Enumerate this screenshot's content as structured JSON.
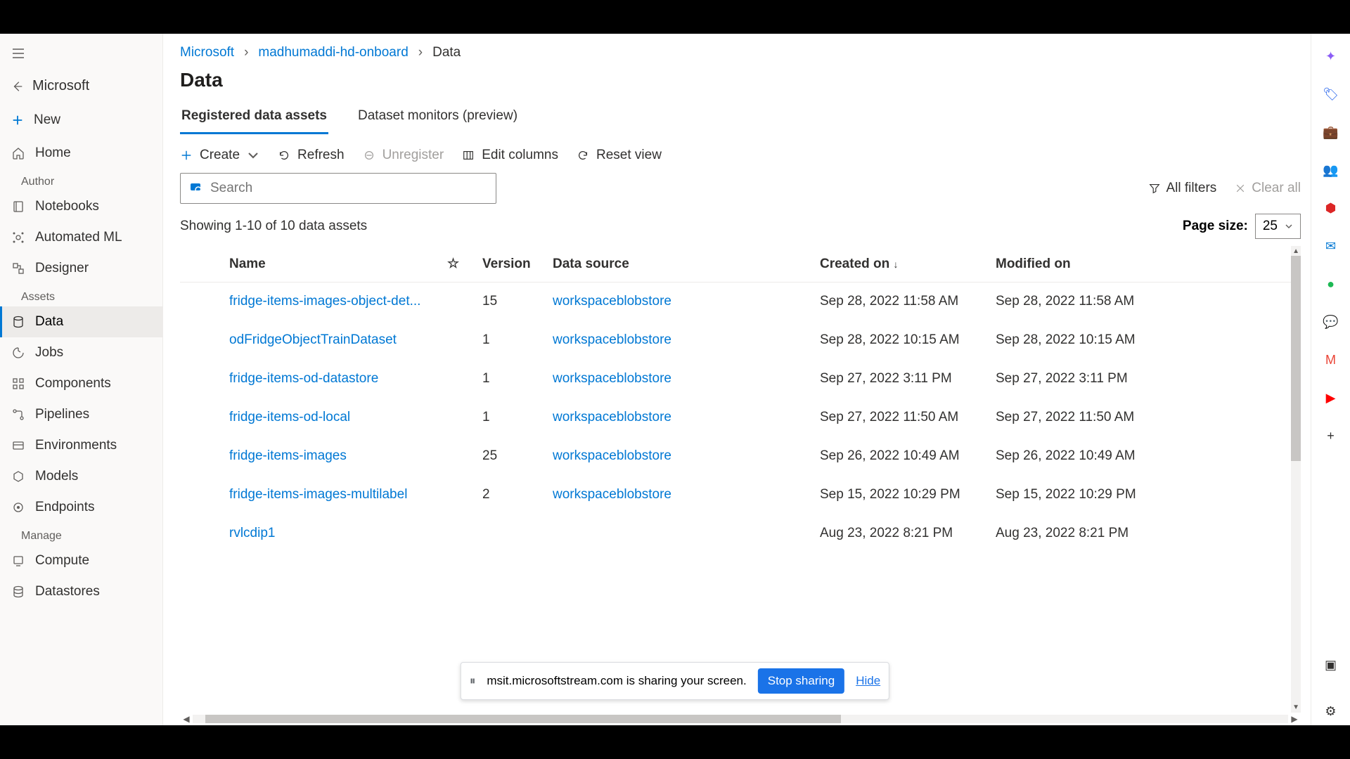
{
  "back_label": "Microsoft",
  "sidebar": {
    "new_label": "New",
    "home_label": "Home",
    "section_author": "Author",
    "notebooks": "Notebooks",
    "automl": "Automated ML",
    "designer": "Designer",
    "section_assets": "Assets",
    "data": "Data",
    "jobs": "Jobs",
    "components": "Components",
    "pipelines": "Pipelines",
    "environments": "Environments",
    "models": "Models",
    "endpoints": "Endpoints",
    "section_manage": "Manage",
    "compute": "Compute",
    "datastores": "Datastores"
  },
  "breadcrumb": {
    "root": "Microsoft",
    "workspace": "madhumaddi-hd-onboard",
    "current": "Data"
  },
  "page_title": "Data",
  "tabs": {
    "registered": "Registered data assets",
    "monitors": "Dataset monitors (preview)"
  },
  "toolbar": {
    "create": "Create",
    "refresh": "Refresh",
    "unregister": "Unregister",
    "edit_columns": "Edit columns",
    "reset_view": "Reset view"
  },
  "search_placeholder": "Search",
  "filters": {
    "all": "All filters",
    "clear": "Clear all"
  },
  "count_text": "Showing 1-10 of 10 data assets",
  "page_size_label": "Page size:",
  "page_size_value": "25",
  "columns": {
    "name": "Name",
    "version": "Version",
    "data_source": "Data source",
    "created_on": "Created on",
    "modified_on": "Modified on"
  },
  "rows": [
    {
      "name": "fridge-items-images-object-det...",
      "version": "15",
      "source": "workspaceblobstore",
      "created": "Sep 28, 2022 11:58 AM",
      "modified": "Sep 28, 2022 11:58 AM"
    },
    {
      "name": "odFridgeObjectTrainDataset",
      "version": "1",
      "source": "workspaceblobstore",
      "created": "Sep 28, 2022 10:15 AM",
      "modified": "Sep 28, 2022 10:15 AM"
    },
    {
      "name": "fridge-items-od-datastore",
      "version": "1",
      "source": "workspaceblobstore",
      "created": "Sep 27, 2022 3:11 PM",
      "modified": "Sep 27, 2022 3:11 PM"
    },
    {
      "name": "fridge-items-od-local",
      "version": "1",
      "source": "workspaceblobstore",
      "created": "Sep 27, 2022 11:50 AM",
      "modified": "Sep 27, 2022 11:50 AM"
    },
    {
      "name": "fridge-items-images",
      "version": "25",
      "source": "workspaceblobstore",
      "created": "Sep 26, 2022 10:49 AM",
      "modified": "Sep 26, 2022 10:49 AM"
    },
    {
      "name": "fridge-items-images-multilabel",
      "version": "2",
      "source": "workspaceblobstore",
      "created": "Sep 15, 2022 10:29 PM",
      "modified": "Sep 15, 2022 10:29 PM"
    },
    {
      "name": "rvlcdip1",
      "version": "",
      "source": "",
      "created": "Aug 23, 2022 8:21 PM",
      "modified": "Aug 23, 2022 8:21 PM"
    }
  ],
  "share_bar": {
    "text": "msit.microsoftstream.com is sharing your screen.",
    "stop": "Stop sharing",
    "hide": "Hide"
  }
}
